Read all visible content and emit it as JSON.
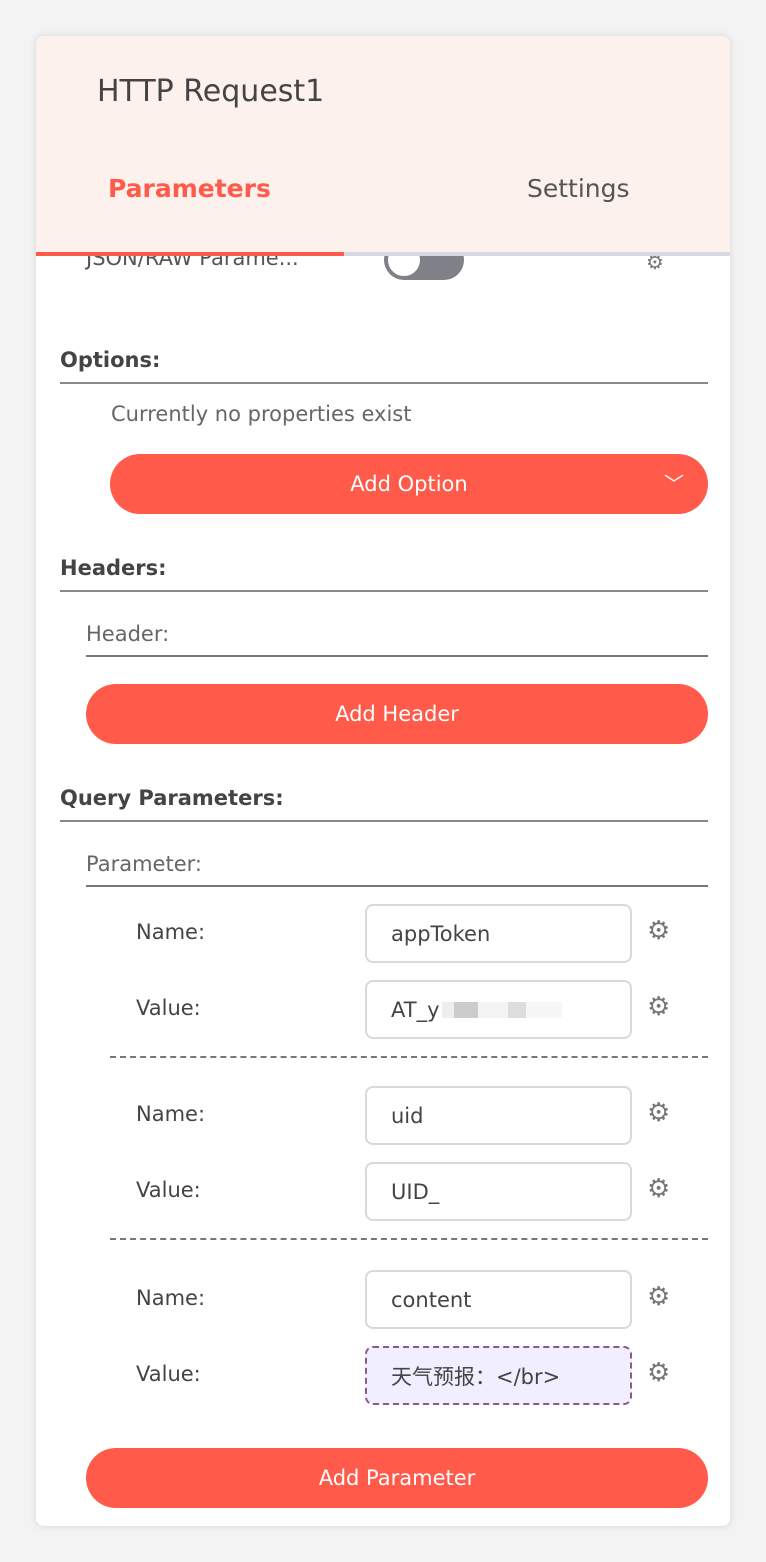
{
  "header": {
    "title": "HTTP Request1",
    "tabs": [
      {
        "label": "Parameters",
        "active": true
      },
      {
        "label": "Settings",
        "active": false
      }
    ]
  },
  "json_raw": {
    "label": "JSON/RAW Parame...",
    "enabled": false
  },
  "options": {
    "title": "Options:",
    "empty_text": "Currently no properties exist",
    "add_button": "Add Option"
  },
  "headers": {
    "title": "Headers:",
    "sub_label": "Header:",
    "add_button": "Add Header"
  },
  "query": {
    "title": "Query Parameters:",
    "sub_label": "Parameter:",
    "name_label": "Name:",
    "value_label": "Value:",
    "params": [
      {
        "name": "appToken",
        "value": "AT_y"
      },
      {
        "name": "uid",
        "value": "UID_"
      },
      {
        "name": "content",
        "value": "天气预报：</br>"
      }
    ],
    "add_button": "Add Parameter"
  },
  "colors": {
    "accent": "#ff5a4a",
    "header_bg": "#fdf1ed"
  }
}
